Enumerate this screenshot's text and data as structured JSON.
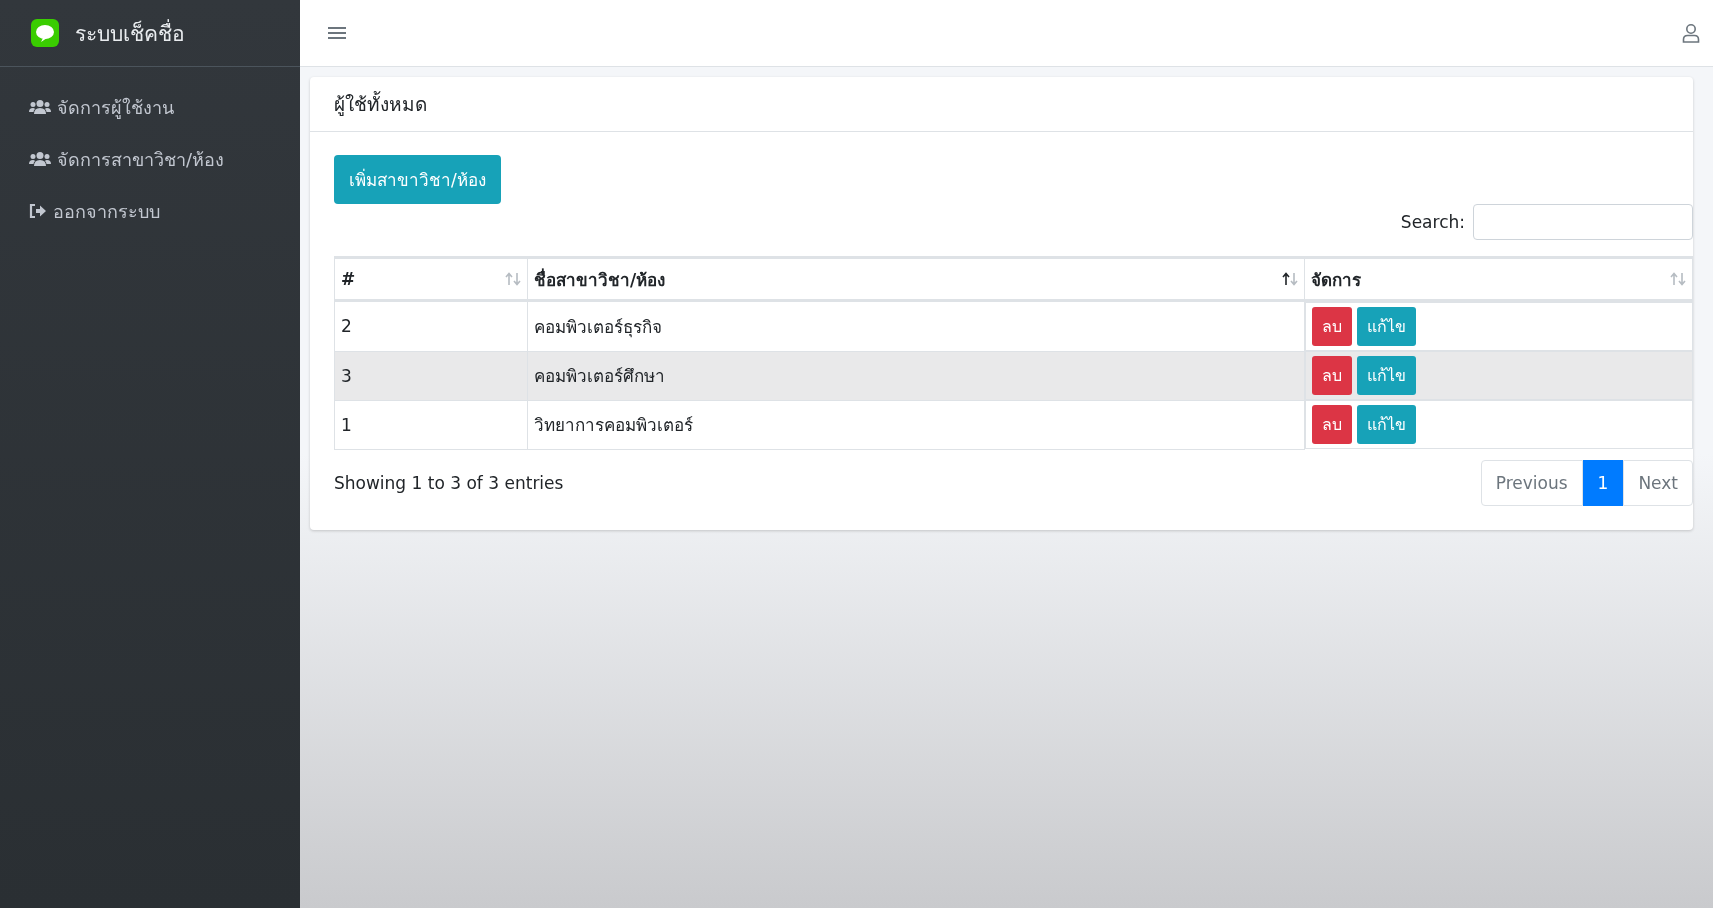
{
  "sidebar": {
    "brand": "ระบบเช็คชื่อ",
    "items": [
      {
        "label": "จัดการผู้ใช้งาน",
        "kind": "users"
      },
      {
        "label": "จัดการสาขาวิชา/ห้อง",
        "kind": "users"
      },
      {
        "label": "ออกจากระบบ",
        "kind": "logout"
      }
    ]
  },
  "card": {
    "title": "ผู้ใช้ทั้งหมด",
    "add_button": "เพิ่มสาขาวิชา/ห้อง",
    "search_label": "Search:",
    "table": {
      "columns": [
        {
          "label": "#",
          "sorted_ascending": false
        },
        {
          "label": "ชื่อสาขาวิชา/ห้อง",
          "sorted_ascending": true
        },
        {
          "label": "จัดการ",
          "sorted_ascending": false
        }
      ],
      "rows": [
        {
          "id": "2",
          "name": "คอมพิวเตอร์ธุรกิจ",
          "delete": "ลบ",
          "edit": "แก้ไข"
        },
        {
          "id": "3",
          "name": "คอมพิวเตอร์ศึกษา",
          "delete": "ลบ",
          "edit": "แก้ไข"
        },
        {
          "id": "1",
          "name": "วิทยาการคอมพิวเตอร์",
          "delete": "ลบ",
          "edit": "แก้ไข"
        }
      ]
    },
    "info": "Showing 1 to 3 of 3 entries",
    "pagination": {
      "previous": "Previous",
      "pages": [
        {
          "label": "1",
          "selected": true
        }
      ],
      "next": "Next"
    }
  }
}
